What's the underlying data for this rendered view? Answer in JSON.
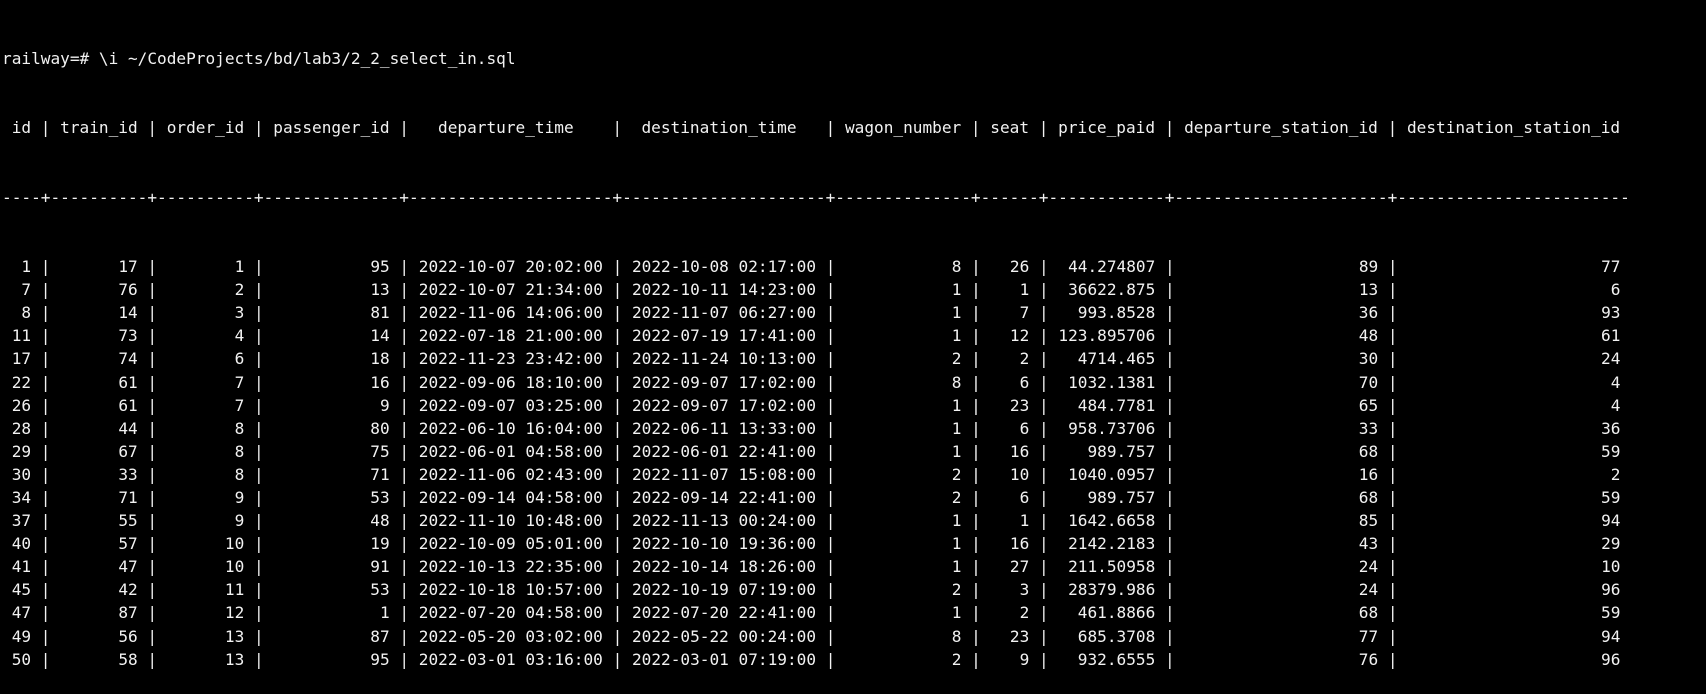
{
  "terminal": {
    "prompt_line": "railway=# \\i ~/CodeProjects/bd/lab3/2_2_select_in.sql",
    "columns": [
      "id",
      "train_id",
      "order_id",
      "passenger_id",
      "departure_time",
      "destination_time",
      "wagon_number",
      "seat",
      "price_paid",
      "departure_station_id",
      "destination_station_id"
    ],
    "rows": [
      [
        "1",
        "17",
        "1",
        "95",
        "2022-10-07 20:02:00",
        "2022-10-08 02:17:00",
        "8",
        "26",
        "44.274807",
        "89",
        "77"
      ],
      [
        "7",
        "76",
        "2",
        "13",
        "2022-10-07 21:34:00",
        "2022-10-11 14:23:00",
        "1",
        "1",
        "36622.875",
        "13",
        "6"
      ],
      [
        "8",
        "14",
        "3",
        "81",
        "2022-11-06 14:06:00",
        "2022-11-07 06:27:00",
        "1",
        "7",
        "993.8528",
        "36",
        "93"
      ],
      [
        "11",
        "73",
        "4",
        "14",
        "2022-07-18 21:00:00",
        "2022-07-19 17:41:00",
        "1",
        "12",
        "123.895706",
        "48",
        "61"
      ],
      [
        "17",
        "74",
        "6",
        "18",
        "2022-11-23 23:42:00",
        "2022-11-24 10:13:00",
        "2",
        "2",
        "4714.465",
        "30",
        "24"
      ],
      [
        "22",
        "61",
        "7",
        "16",
        "2022-09-06 18:10:00",
        "2022-09-07 17:02:00",
        "8",
        "6",
        "1032.1381",
        "70",
        "4"
      ],
      [
        "26",
        "61",
        "7",
        "9",
        "2022-09-07 03:25:00",
        "2022-09-07 17:02:00",
        "1",
        "23",
        "484.7781",
        "65",
        "4"
      ],
      [
        "28",
        "44",
        "8",
        "80",
        "2022-06-10 16:04:00",
        "2022-06-11 13:33:00",
        "1",
        "6",
        "958.73706",
        "33",
        "36"
      ],
      [
        "29",
        "67",
        "8",
        "75",
        "2022-06-01 04:58:00",
        "2022-06-01 22:41:00",
        "1",
        "16",
        "989.757",
        "68",
        "59"
      ],
      [
        "30",
        "33",
        "8",
        "71",
        "2022-11-06 02:43:00",
        "2022-11-07 15:08:00",
        "2",
        "10",
        "1040.0957",
        "16",
        "2"
      ],
      [
        "34",
        "71",
        "9",
        "53",
        "2022-09-14 04:58:00",
        "2022-09-14 22:41:00",
        "2",
        "6",
        "989.757",
        "68",
        "59"
      ],
      [
        "37",
        "55",
        "9",
        "48",
        "2022-11-10 10:48:00",
        "2022-11-13 00:24:00",
        "1",
        "1",
        "1642.6658",
        "85",
        "94"
      ],
      [
        "40",
        "57",
        "10",
        "19",
        "2022-10-09 05:01:00",
        "2022-10-10 19:36:00",
        "1",
        "16",
        "2142.2183",
        "43",
        "29"
      ],
      [
        "41",
        "47",
        "10",
        "91",
        "2022-10-13 22:35:00",
        "2022-10-14 18:26:00",
        "1",
        "27",
        "211.50958",
        "24",
        "10"
      ],
      [
        "45",
        "42",
        "11",
        "53",
        "2022-10-18 10:57:00",
        "2022-10-19 07:19:00",
        "2",
        "3",
        "28379.986",
        "24",
        "96"
      ],
      [
        "47",
        "87",
        "12",
        "1",
        "2022-07-20 04:58:00",
        "2022-07-20 22:41:00",
        "1",
        "2",
        "461.8866",
        "68",
        "59"
      ],
      [
        "49",
        "56",
        "13",
        "87",
        "2022-05-20 03:02:00",
        "2022-05-22 00:24:00",
        "8",
        "23",
        "685.3708",
        "77",
        "94"
      ],
      [
        "50",
        "58",
        "13",
        "95",
        "2022-03-01 03:16:00",
        "2022-03-01 07:19:00",
        "2",
        "9",
        "932.6555",
        "76",
        "96"
      ]
    ]
  }
}
